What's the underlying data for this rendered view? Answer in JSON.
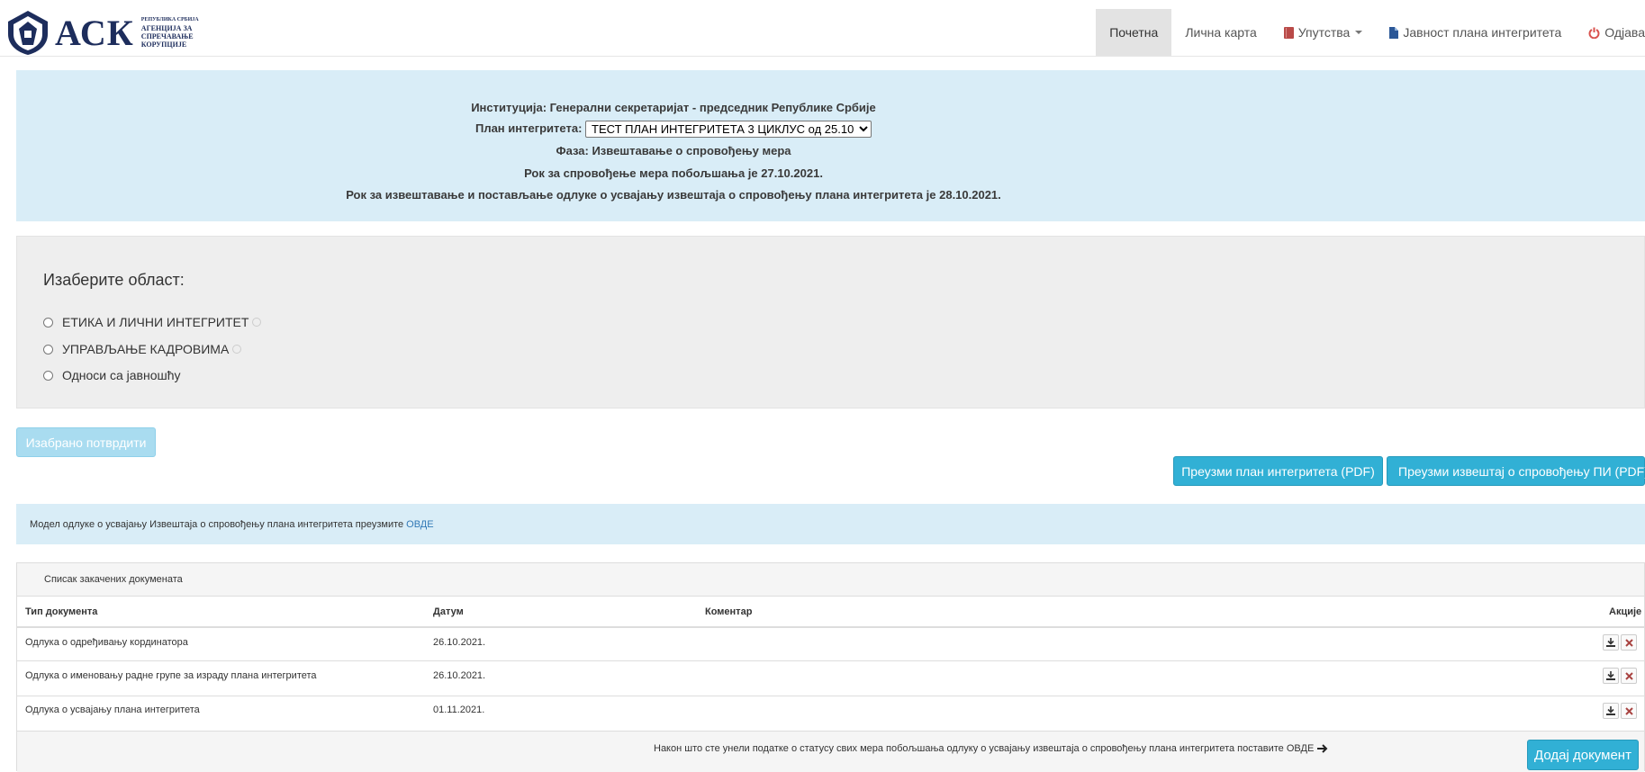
{
  "logo": {
    "brand": "АСК",
    "sub_line1": "РЕПУБЛИКА СРБИЈА",
    "sub_line2": "АГЕНЦИЈА ЗА",
    "sub_line3": "СПРЕЧАВАЊЕ",
    "sub_line4": "КОРУПЦИЈЕ"
  },
  "nav": {
    "home": "Почетна",
    "profile": "Лична карта",
    "instructions": "Упутства",
    "publicity": "Јавност плана интегритета",
    "logout": "Одјава"
  },
  "info": {
    "institution": "Институција: Генерални секретаријат - председник Републике Србије",
    "plan_label": "План интегритета:",
    "plan_selected": "ТЕСТ ПЛАН ИНТЕГРИТЕТА 3 ЦИКЛУС од 25.10",
    "phase": "Фаза: Извештавање о спровођењу мера",
    "deadline_measures": "Рок за спровођење мера побољшања је 27.10.2021.",
    "deadline_report": "Рок за извештавање и постављање одлуке о усвајању извештаја о спровођењу плана интегритета је 28.10.2021."
  },
  "area": {
    "title": "Изаберите област:",
    "options": [
      "ЕТИКА И ЛИЧНИ ИНТЕГРИТЕТ",
      "УПРАВЉАЊЕ КАДРОВИМА",
      "Односи са јавношћу"
    ]
  },
  "buttons": {
    "confirm": "Изабрано потврдити",
    "download_plan": "Преузми план интегритета (PDF)",
    "download_report": "Преузми извештај о спровођењу ПИ (PDF)",
    "add_document": "Додај документ"
  },
  "notice": {
    "text": "Модел одлуке о усвајању Извештаја о спровођењу плана интегритета преузмите",
    "link": "ОВДЕ"
  },
  "documents": {
    "title": "Списак закачених докумената",
    "columns": [
      "Тип документа",
      "Датум",
      "Коментар",
      "Акције"
    ],
    "rows": [
      {
        "type": "Одлука о одређивању кординатора",
        "date": "26.10.2021.",
        "comment": ""
      },
      {
        "type": "Одлука о именовању радне групе за израду плана интегритета",
        "date": "26.10.2021.",
        "comment": ""
      },
      {
        "type": "Одлука о усвајању плана интегритета",
        "date": "01.11.2021.",
        "comment": ""
      }
    ],
    "footer_text": "Након што сте унели податке о статусу свих мера побољшања одлуку о усвајању извештаја о спровођењу плана интегритета поставите ОВДЕ"
  },
  "icons": {
    "instructions": "book-icon",
    "publicity": "file-icon",
    "logout": "power-icon",
    "download": "download-icon",
    "delete": "remove-icon",
    "arrow": "arrow-right-icon"
  },
  "colors": {
    "info_bg": "#d9edf7",
    "btn_info": "#31b0d5",
    "delete_red": "#a94442",
    "logout_red": "#d9534f",
    "book_red": "#b94a48",
    "brand_navy": "#1d2d5c"
  }
}
